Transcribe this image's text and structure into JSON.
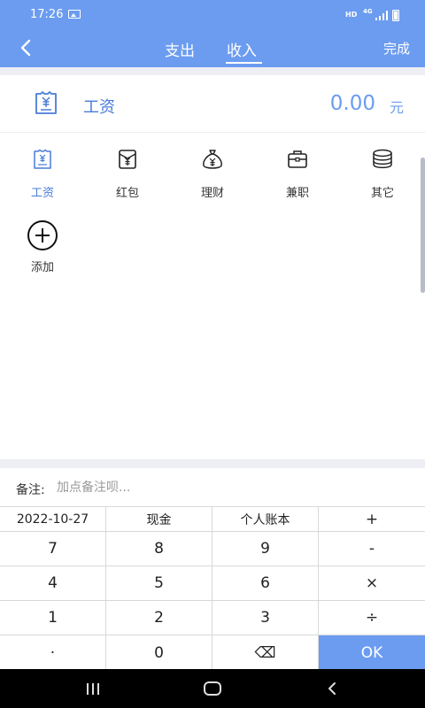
{
  "status_bar": {
    "time": "17:26",
    "hd": "HD",
    "network": "4G"
  },
  "header": {
    "tabs": [
      {
        "label": "支出"
      },
      {
        "label": "收入"
      }
    ],
    "active_tab": "收入",
    "done_label": "完成"
  },
  "amount_row": {
    "category": "工资",
    "amount": "0.00",
    "unit": "元",
    "icon": "salary-icon"
  },
  "categories": [
    {
      "label": "工资",
      "icon": "salary-icon",
      "selected": true
    },
    {
      "label": "红包",
      "icon": "red-envelope-icon",
      "selected": false
    },
    {
      "label": "理财",
      "icon": "money-bag-icon",
      "selected": false
    },
    {
      "label": "兼职",
      "icon": "briefcase-icon",
      "selected": false
    },
    {
      "label": "其它",
      "icon": "coin-stack-icon",
      "selected": false
    }
  ],
  "add_category": {
    "label": "添加",
    "icon": "plus-circle-icon"
  },
  "remark": {
    "label": "备注:",
    "placeholder": "加点备注呗..."
  },
  "keypad": {
    "row0": [
      "2022-10-27",
      "现金",
      "个人账本",
      "+"
    ],
    "row1": [
      "7",
      "8",
      "9",
      "-"
    ],
    "row2": [
      "4",
      "5",
      "6",
      "×"
    ],
    "row3": [
      "1",
      "2",
      "3",
      "÷"
    ],
    "row4": [
      "·",
      "0",
      "⌫",
      "OK"
    ]
  },
  "colors": {
    "accent": "#6b9cf0",
    "selected_text": "#4a7cd8",
    "divider": "#eeeff4"
  }
}
